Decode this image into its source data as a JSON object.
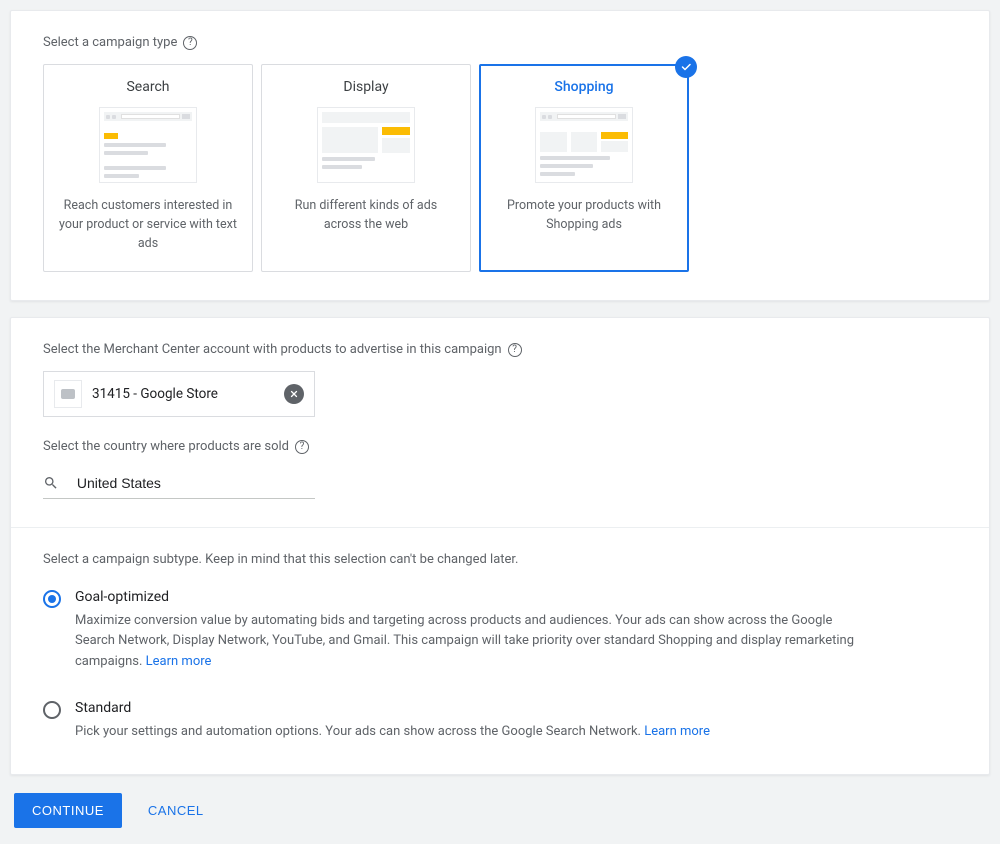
{
  "campaignType": {
    "label": "Select a campaign type",
    "options": [
      {
        "title": "Search",
        "desc": "Reach customers interested in your product or service with text ads"
      },
      {
        "title": "Display",
        "desc": "Run different kinds of ads across the web"
      },
      {
        "title": "Shopping",
        "desc": "Promote your products with Shopping ads"
      }
    ],
    "selectedIndex": 2
  },
  "merchant": {
    "label": "Select the Merchant Center account with products to advertise in this campaign",
    "value": "31415 - Google Store"
  },
  "country": {
    "label": "Select the country where products are sold",
    "value": "United States"
  },
  "subtype": {
    "label": "Select a campaign subtype. Keep in mind that this selection can't be changed later.",
    "options": [
      {
        "title": "Goal-optimized",
        "desc": "Maximize conversion value by automating bids and targeting across products and audiences. Your ads can show across the Google Search Network, Display Network, YouTube, and Gmail. This campaign will take priority over standard Shopping and display remarketing campaigns. ",
        "learn": "Learn more"
      },
      {
        "title": "Standard",
        "desc": "Pick your settings and automation options. Your ads can show across the Google Search Network. ",
        "learn": "Learn more"
      }
    ],
    "selectedIndex": 0
  },
  "buttons": {
    "continue": "CONTINUE",
    "cancel": "CANCEL"
  }
}
